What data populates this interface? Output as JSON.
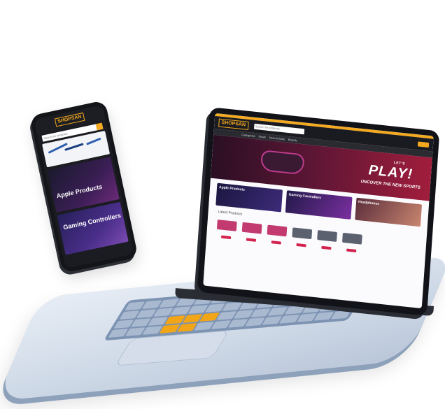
{
  "laptop": {
    "logo": "SHOPSAN",
    "search_placeholder": "Search for products",
    "subnav": [
      "Categories",
      "Deals",
      "New Arrivals",
      "Brands"
    ],
    "hero": {
      "tagline": "LET'S",
      "title": "PLAY!",
      "subtitle": "UNCOVER THE NEW SPORTS"
    },
    "tiles": [
      "Apple Products",
      "Gaming Controllers",
      "Headphones"
    ],
    "section_title": "Latest Products",
    "product_count": 6
  },
  "phone": {
    "logo": "SHOPSAN",
    "search_placeholder": "Search for products",
    "banner1_text": "Apple Products",
    "banner2_text": "Gaming Controllers"
  },
  "colors": {
    "accent": "#f4a91f",
    "brand_dark": "#1a1b20",
    "buy_button": "#d3224e",
    "device_base": "#cdd8e6"
  }
}
